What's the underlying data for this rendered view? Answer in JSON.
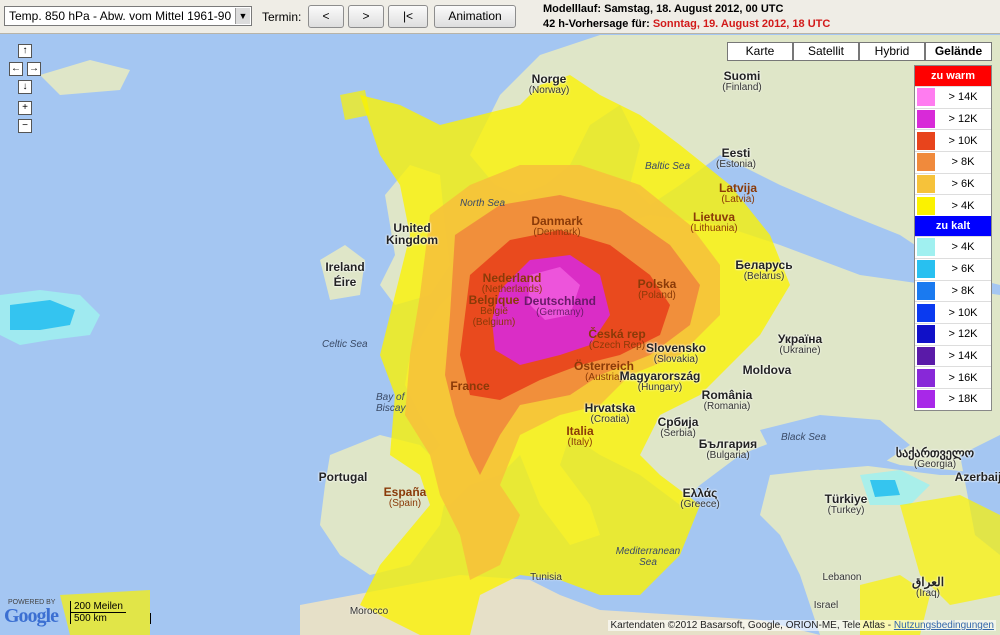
{
  "toolbar": {
    "parameter_select": "Temp. 850 hPa - Abw. vom Mittel 1961-90",
    "termin_label": "Termin:",
    "prev_label": "<",
    "next_label": ">",
    "first_label": "|<",
    "animation_label": "Animation",
    "run_info": "Modelllauf: Samstag, 18. August 2012, 00 UTC",
    "forecast_prefix": "42 h-Vorhersage für:",
    "forecast_date": "Sonntag, 19. August 2012, 18 UTC"
  },
  "map_controls": {
    "pan_up": "↑",
    "pan_left": "←",
    "pan_right": "→",
    "pan_down": "↓",
    "zoom_in": "+",
    "zoom_out": "−"
  },
  "map_types": [
    "Karte",
    "Satellit",
    "Hybrid",
    "Gelände"
  ],
  "map_type_active": "Gelände",
  "legend": {
    "warm_title": "zu warm",
    "warm_color": "#ff0000",
    "warm_rows": [
      {
        "label": "> 14K",
        "color": "#ff7cf0"
      },
      {
        "label": "> 12K",
        "color": "#d82ad8"
      },
      {
        "label": "> 10K",
        "color": "#e8441c"
      },
      {
        "label": "> 8K",
        "color": "#f08a3c"
      },
      {
        "label": "> 6K",
        "color": "#f6c23a"
      },
      {
        "label": "> 4K",
        "color": "#fbf200"
      }
    ],
    "cold_title": "zu kalt",
    "cold_color": "#0000ff",
    "cold_rows": [
      {
        "label": "> 4K",
        "color": "#a0f0f0"
      },
      {
        "label": "> 6K",
        "color": "#28c0f0"
      },
      {
        "label": "> 8K",
        "color": "#1a7af0"
      },
      {
        "label": "> 10K",
        "color": "#0a3af0"
      },
      {
        "label": "> 12K",
        "color": "#1010c8"
      },
      {
        "label": "> 14K",
        "color": "#5a1aa8"
      },
      {
        "label": "> 16K",
        "color": "#8828d8"
      },
      {
        "label": "> 18K",
        "color": "#a828e8"
      }
    ]
  },
  "countries": [
    {
      "name": "Norge",
      "local": "(Norway)"
    },
    {
      "name": "Suomi",
      "local": "(Finland)"
    },
    {
      "name": "Eesti",
      "local": "(Estonia)"
    },
    {
      "name": "Latvija",
      "local": "(Latvia)"
    },
    {
      "name": "Lietuva",
      "local": "(Lithuania)"
    },
    {
      "name": "Беларусь",
      "local": "(Belarus)"
    },
    {
      "name": "Danmark",
      "local": "(Denmark)"
    },
    {
      "name": "United Kingdom",
      "local": ""
    },
    {
      "name": "Ireland",
      "local": ""
    },
    {
      "name": "Éire",
      "local": ""
    },
    {
      "name": "Nederland",
      "local": "(Netherlands)"
    },
    {
      "name": "Deutschland",
      "local": "(Germany)"
    },
    {
      "name": "Polska",
      "local": "(Poland)"
    },
    {
      "name": "Belgique",
      "local": "België"
    },
    {
      "name": "(Belgium)",
      "local": ""
    },
    {
      "name": "Česká rep",
      "local": "(Czech Rep)"
    },
    {
      "name": "Slovensko",
      "local": "(Slovakia)"
    },
    {
      "name": "Україна",
      "local": "(Ukraine)"
    },
    {
      "name": "Moldova",
      "local": ""
    },
    {
      "name": "France",
      "local": ""
    },
    {
      "name": "Österreich",
      "local": "(Austria)"
    },
    {
      "name": "Magyarország",
      "local": "(Hungary)"
    },
    {
      "name": "România",
      "local": "(Romania)"
    },
    {
      "name": "Hrvatska",
      "local": "(Croatia)"
    },
    {
      "name": "Србија",
      "local": "(Serbia)"
    },
    {
      "name": "България",
      "local": "(Bulgaria)"
    },
    {
      "name": "Italia",
      "local": "(Italy)"
    },
    {
      "name": "Portugal",
      "local": ""
    },
    {
      "name": "España",
      "local": "(Spain)"
    },
    {
      "name": "Ελλάς",
      "local": "(Greece)"
    },
    {
      "name": "Türkiye",
      "local": "(Turkey)"
    },
    {
      "name": "საქართველო",
      "local": "(Georgia)"
    },
    {
      "name": "Azerbaij",
      "local": ""
    },
    {
      "name": "Tunisia",
      "local": ""
    },
    {
      "name": "Morocco",
      "local": ""
    },
    {
      "name": "Lebanon",
      "local": ""
    },
    {
      "name": "Israel",
      "local": ""
    },
    {
      "name": "العراق",
      "local": "(Iraq)"
    }
  ],
  "seas": [
    "Baltic Sea",
    "North Sea",
    "Celtic Sea",
    "Bay of Biscay",
    "Black Sea",
    "Mediterranean Sea"
  ],
  "footer": {
    "powered": "POWERED BY",
    "google": "Google",
    "scale_top": "200 Meilen",
    "scale_bottom": "500 km",
    "attribution": "Kartendaten ©2012 Basarsoft, Google, ORION-ME, Tele Atlas -",
    "terms_link": "Nutzungsbedingungen"
  }
}
